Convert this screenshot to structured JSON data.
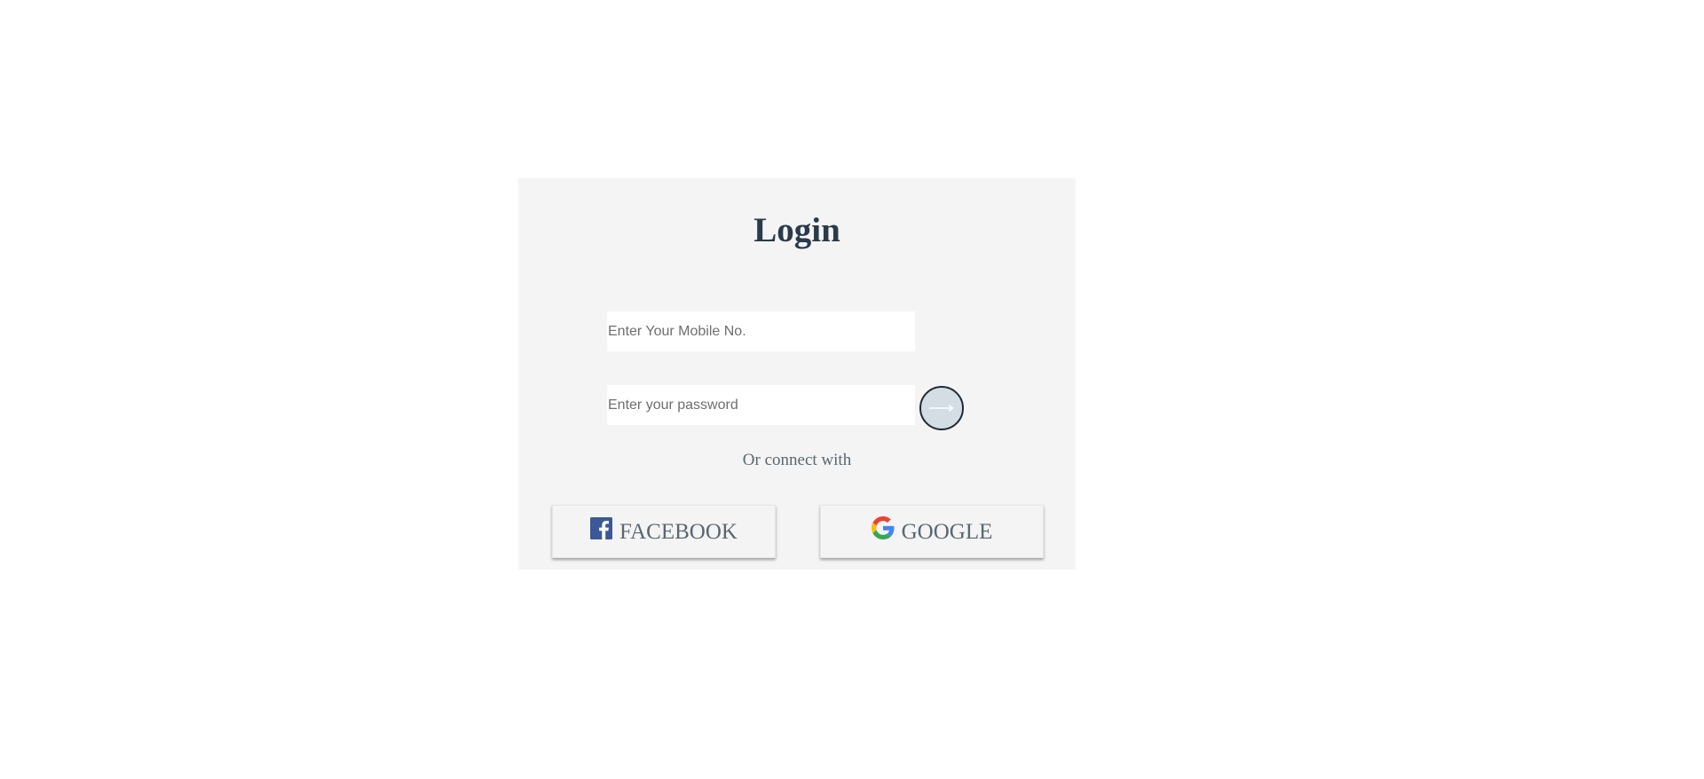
{
  "login": {
    "title": "Login",
    "mobile_placeholder": "Enter Your Mobile No.",
    "password_placeholder": "Enter your password",
    "submit_icon": "arrow-right-icon",
    "or_text": "Or connect with",
    "facebook_label": "FACEBOOK",
    "google_label": "GOOGLE"
  },
  "colors": {
    "page_background": "#ffffff",
    "card_background": "#f4f4f4",
    "title": "#2a3b4a",
    "muted_text": "#5b6670",
    "submit_fill": "#d3dde3",
    "facebook_blue": "#3b5998"
  },
  "icons": {
    "facebook": "facebook-icon",
    "google": "google-icon"
  }
}
